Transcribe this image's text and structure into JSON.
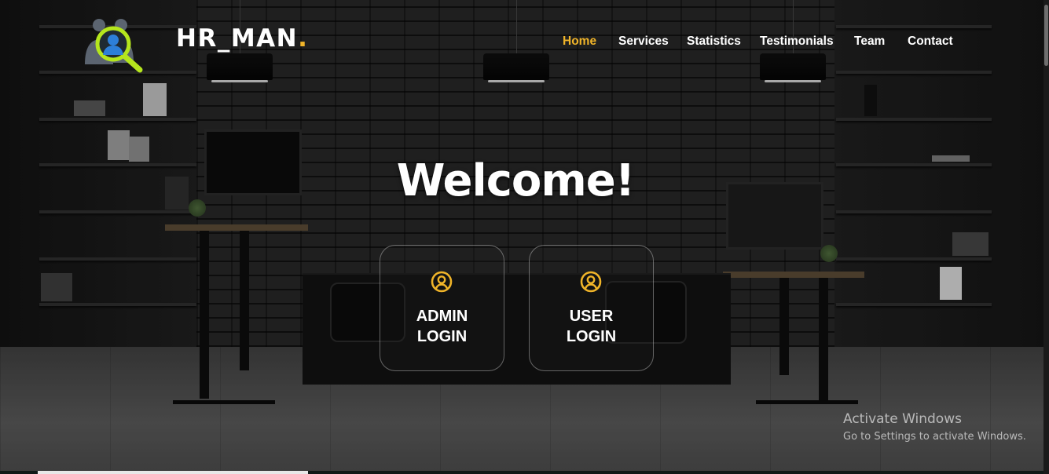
{
  "brand": {
    "name": "HR_MAN",
    "dot": "."
  },
  "nav": {
    "items": [
      {
        "label": "Home",
        "active": true
      },
      {
        "label": "Services"
      },
      {
        "label": "Statistics"
      },
      {
        "label": "Testimonials"
      },
      {
        "label": "Team"
      },
      {
        "label": "Contact"
      }
    ]
  },
  "hero": {
    "title": "Welcome!",
    "admin_login": "ADMIN\nLOGIN",
    "user_login": "USER\nLOGIN"
  },
  "watermark": {
    "title": "Activate Windows",
    "subtitle": "Go to Settings to activate Windows."
  },
  "colors": {
    "accent": "#f0b429",
    "text": "#ffffff",
    "logo_green": "#b5e61d",
    "logo_blue": "#2d7fd8"
  },
  "icons": {
    "logo": "magnifier-user-icon",
    "login": "user-circle-icon"
  }
}
